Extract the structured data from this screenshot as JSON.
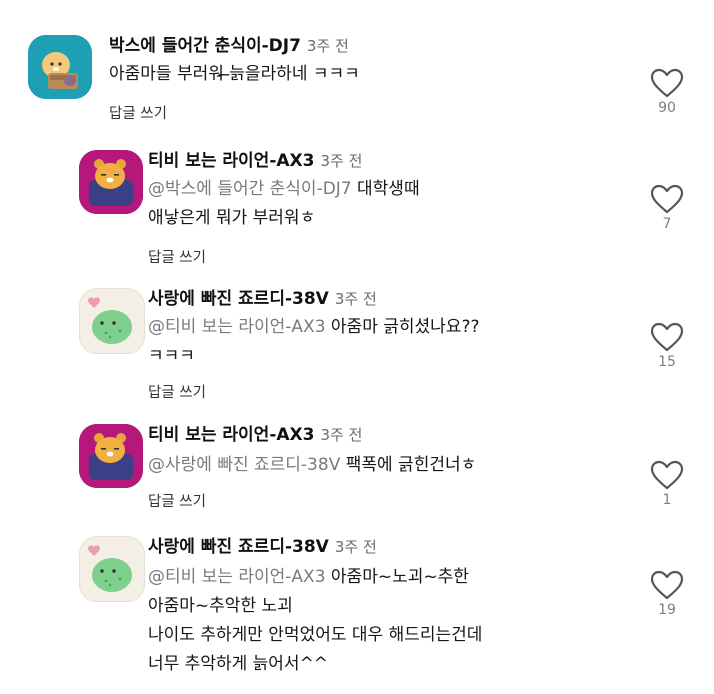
{
  "comments": [
    {
      "author": "박스에 들어간 춘식이-DJ7",
      "time": "3주 전",
      "mention": "",
      "lines": [
        "아줌마들 부러워 ̶늙을라하네 ㅋㅋㅋ"
      ],
      "reply_label": "답글 쓰기",
      "likes": "90",
      "avatar_bg": "#1f9fb4",
      "avatar_icon": "chunsik-box-avatar"
    },
    {
      "author": "티비 보는 라이언-AX3",
      "time": "3주 전",
      "mention": "@박스에 들어간 춘식이-DJ7",
      "lines": [
        " 대학생때",
        "애낳은게 뭐가 부러워ㅎ"
      ],
      "reply_label": "답글 쓰기",
      "likes": "7",
      "avatar_bg": "#b3187a",
      "avatar_icon": "ryan-tv-avatar"
    },
    {
      "author": "사랑에 빠진 죠르디-38V",
      "time": "3주 전",
      "mention": "@티비 보는 라이언-AX3",
      "lines": [
        " 아줌마 긁히셨나요??",
        "ㅋㅋㅋ"
      ],
      "reply_label": "답글 쓰기",
      "likes": "15",
      "avatar_bg": "#f4efe4",
      "avatar_icon": "jordy-love-avatar"
    },
    {
      "author": "티비 보는 라이언-AX3",
      "time": "3주 전",
      "mention": "@사랑에 빠진 죠르디-38V",
      "lines": [
        " 팩폭에 긁힌건너ㅎ"
      ],
      "reply_label": "답글 쓰기",
      "likes": "1",
      "avatar_bg": "#b3187a",
      "avatar_icon": "ryan-tv-avatar"
    },
    {
      "author": "사랑에 빠진 죠르디-38V",
      "time": "3주 전",
      "mention": "@티비 보는 라이언-AX3",
      "lines": [
        " 아줌마~노괴~추한",
        "아줌마~추악한 노괴",
        "나이도 추하게만 안먹었어도 대우 해드리는건데",
        "너무 추악하게 늙어서^^"
      ],
      "reply_label": "",
      "likes": "19",
      "avatar_bg": "#f4efe4",
      "avatar_icon": "jordy-love-avatar"
    }
  ]
}
